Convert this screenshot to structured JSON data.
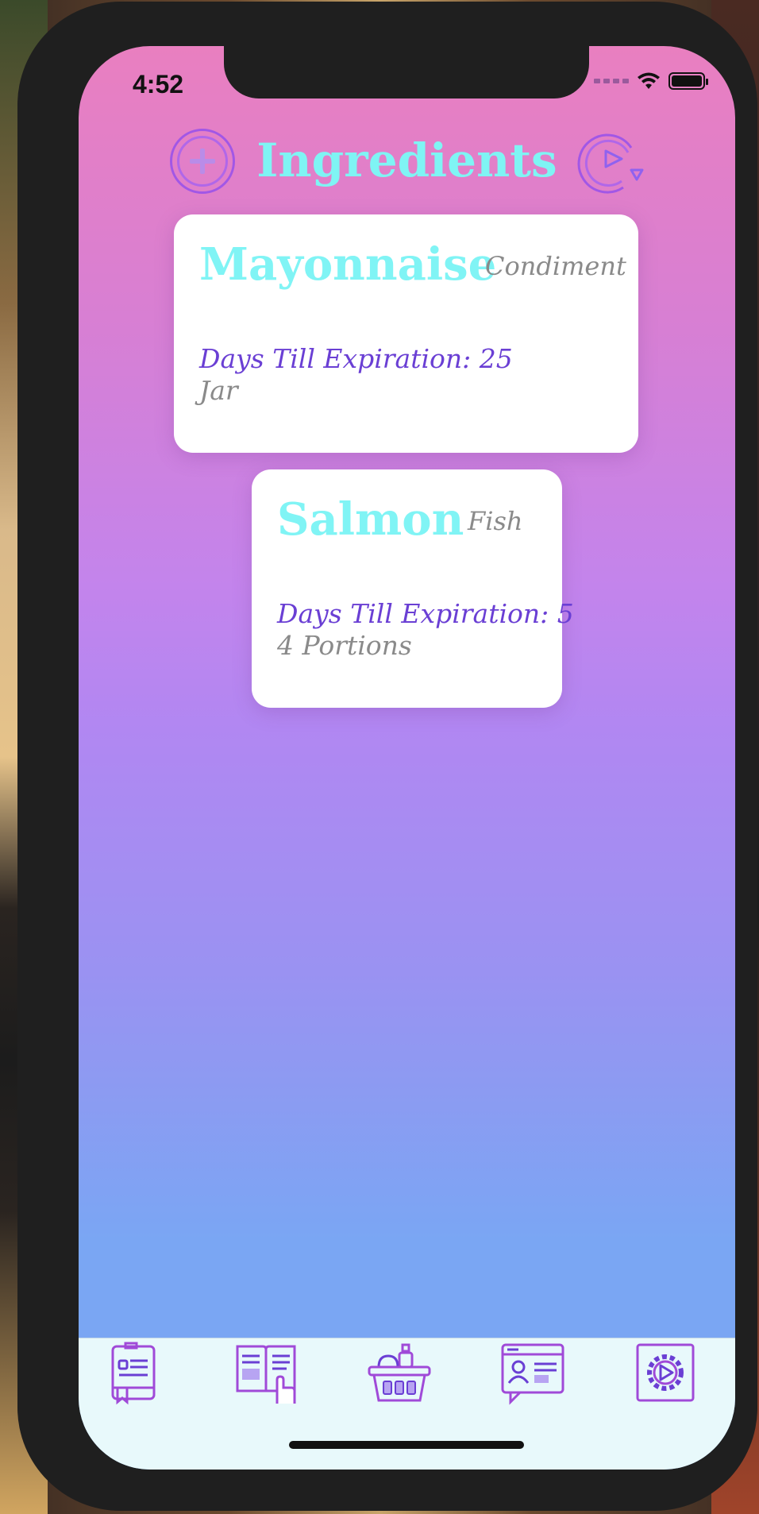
{
  "status_bar": {
    "time": "4:52"
  },
  "header": {
    "title": "Ingredients",
    "add_icon": "plus-circle-icon",
    "refresh_icon": "refresh-play-icon"
  },
  "ingredients": [
    {
      "name": "Mayonnaise",
      "category": "Condiment",
      "expiry": "Days Till Expiration: 25",
      "quantity": "Jar"
    },
    {
      "name": "Salmon",
      "category": "Fish",
      "expiry": "Days Till Expiration: 5",
      "quantity": "4 Portions"
    }
  ],
  "tab_bar": {
    "tabs": [
      {
        "icon": "recipe-card-icon"
      },
      {
        "icon": "recipe-book-icon"
      },
      {
        "icon": "grocery-basket-icon"
      },
      {
        "icon": "profile-page-icon"
      },
      {
        "icon": "settings-gear-icon"
      }
    ]
  },
  "colors": {
    "accent_cyan": "#7ff4f4",
    "accent_purple": "#6a3fd4",
    "icon_purple": "#a157e6"
  }
}
